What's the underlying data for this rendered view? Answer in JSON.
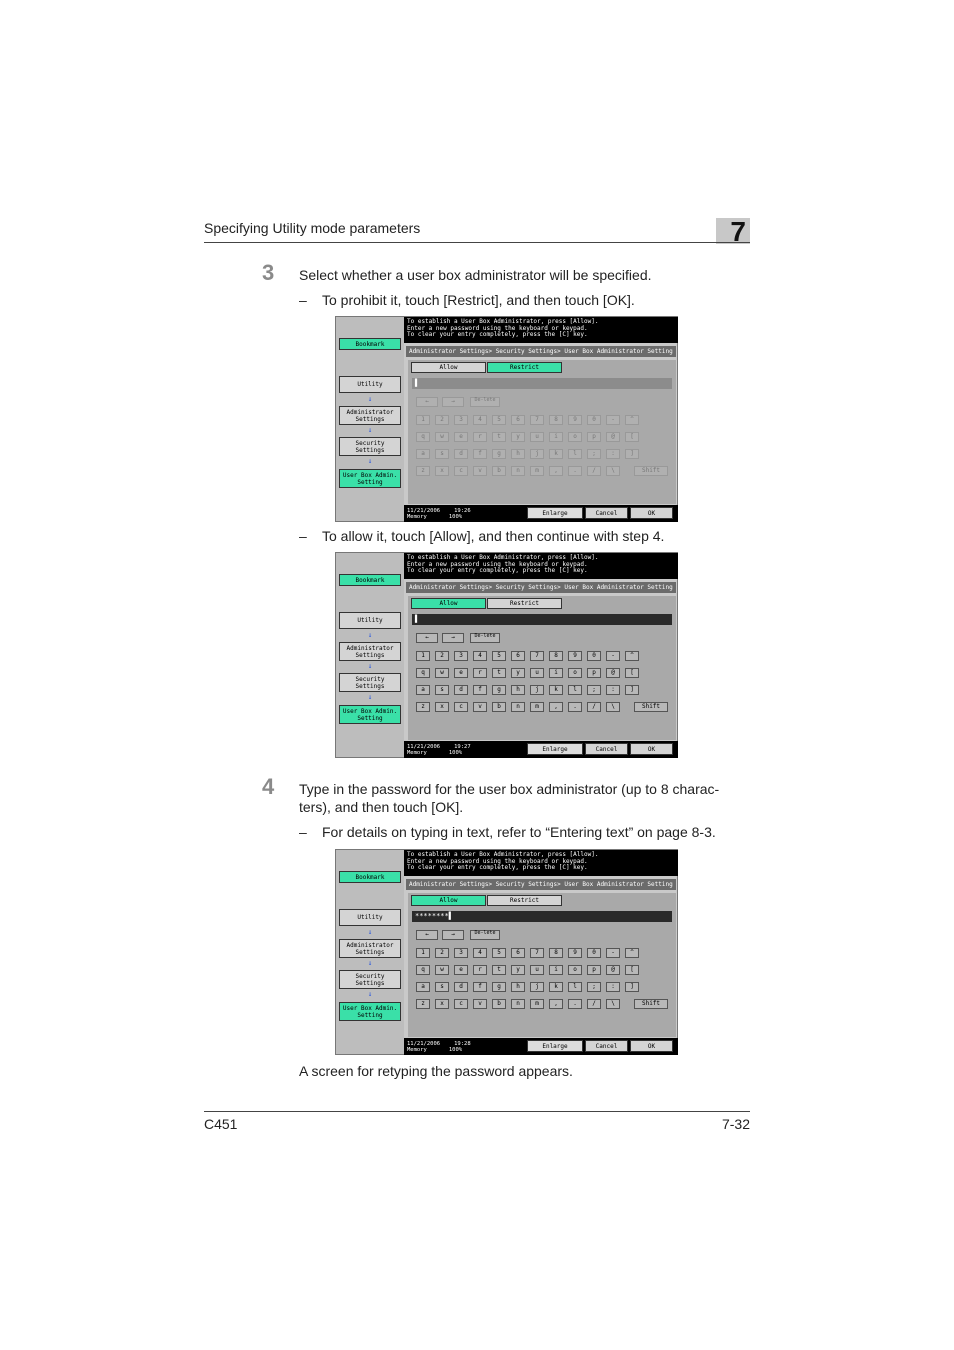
{
  "header": {
    "title": "Specifying Utility mode parameters",
    "chapter": "7"
  },
  "steps": [
    {
      "number": "3",
      "text": "Select whether a user box administrator will be specified."
    },
    {
      "number": "4",
      "text": "Type in the password for the user box administrator (up to 8 charac-ters), and then touch [OK]."
    }
  ],
  "sub": {
    "restrict": "To prohibit it, touch [Restrict], and then touch [OK].",
    "allow": "To allow it, touch [Allow], and then continue with step 4.",
    "details": "For details on typing in text, refer to “Entering text” on page 8-3."
  },
  "retype_note": "A screen for retyping the password appears.",
  "footer": {
    "model": "C451",
    "page": "7-32"
  },
  "screen": {
    "message": [
      "To establish a User Box Administrator, press [Allow].",
      "Enter a new password using the keyboard or keypad.",
      "To clear your entry completely, press the [C] key."
    ],
    "bookmark": "Bookmark",
    "utility": "Utility",
    "admin_settings": "Administrator Settings",
    "security_settings": "Security Settings",
    "user_box": "User Box Admin. Setting",
    "path": "Administrator Settings> Security Settings> User Box Administrator Setting",
    "allow": "Allow",
    "restrict": "Restrict",
    "delete": "De-lete",
    "shift": "Shift",
    "enlarge": "Enlarge",
    "cancel": "Cancel",
    "ok": "OK",
    "memory_label": "Memory",
    "memory_value": "100%",
    "date": "11/21/2006",
    "times": [
      "19:26",
      "19:27",
      "19:28"
    ],
    "password_entry": "********",
    "row1": [
      "1",
      "2",
      "3",
      "4",
      "5",
      "6",
      "7",
      "8",
      "9",
      "0",
      "-",
      "^"
    ],
    "row2": [
      "q",
      "w",
      "e",
      "r",
      "t",
      "y",
      "u",
      "i",
      "o",
      "p",
      "@",
      "["
    ],
    "row3": [
      "a",
      "s",
      "d",
      "f",
      "g",
      "h",
      "j",
      "k",
      "l",
      ";",
      ":",
      "]"
    ],
    "row4": [
      "z",
      "x",
      "c",
      "v",
      "b",
      "n",
      "m",
      ",",
      ".",
      "/",
      "\\"
    ]
  }
}
